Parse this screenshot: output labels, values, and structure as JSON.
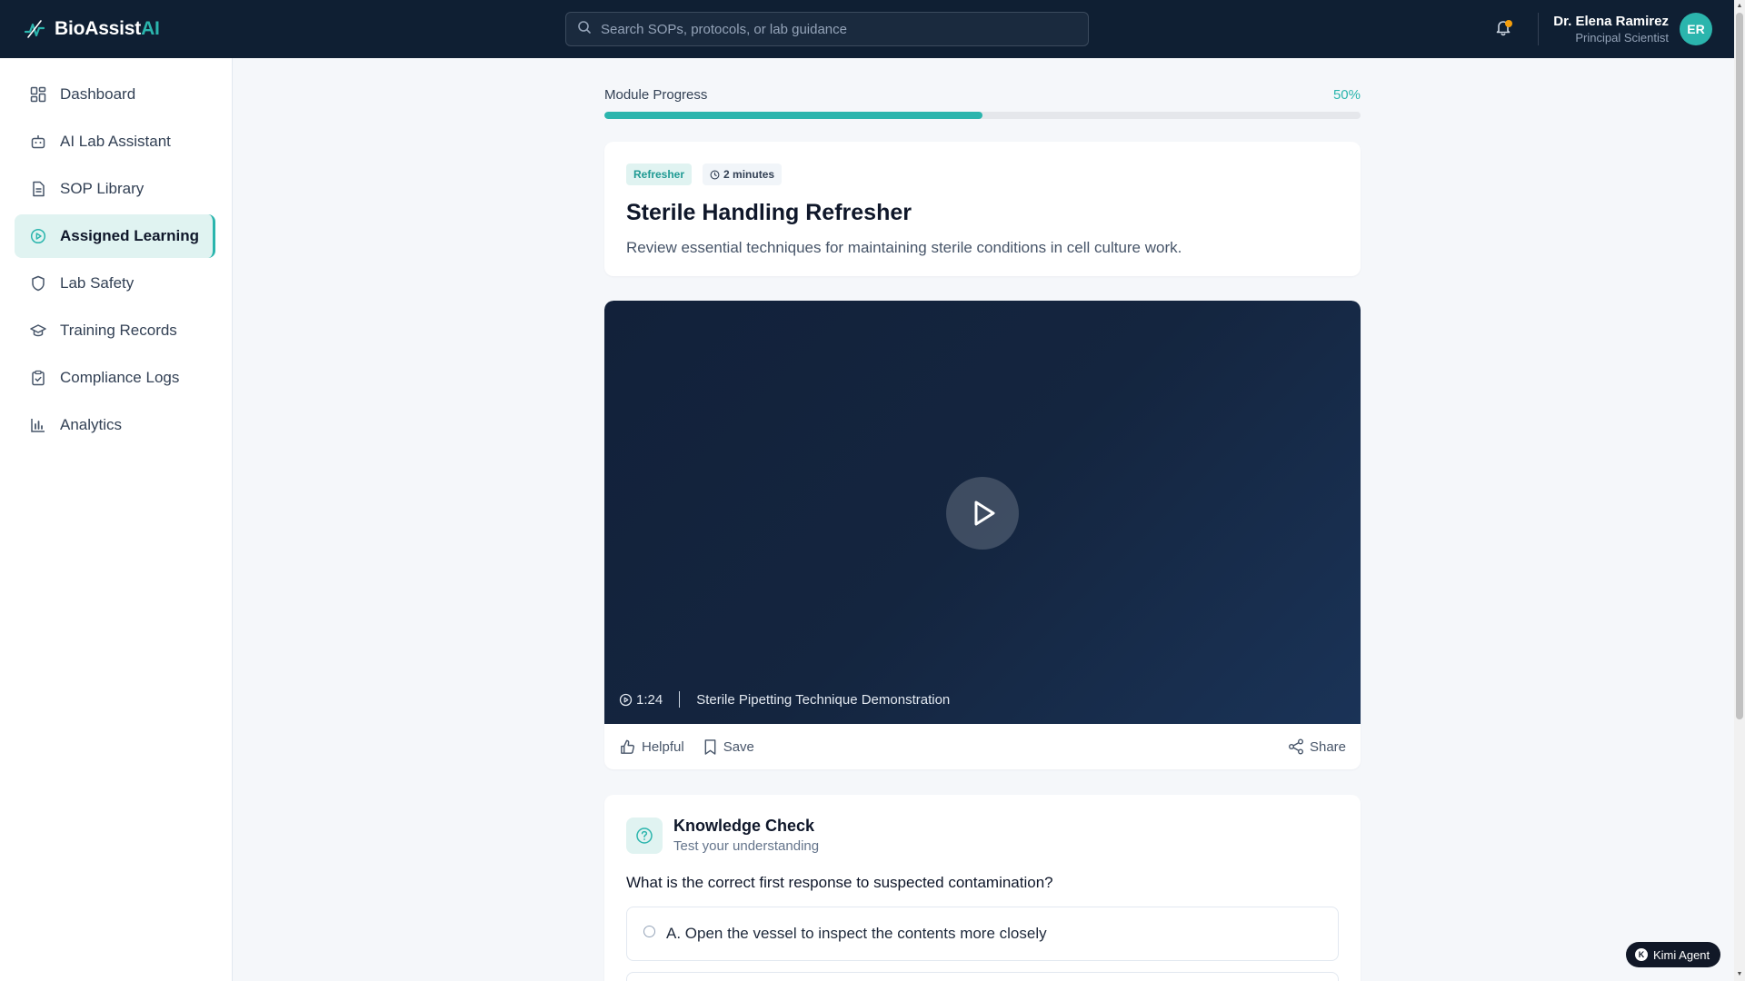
{
  "brand": {
    "name": "BioAssist",
    "suffix": "AI"
  },
  "search": {
    "placeholder": "Search SOPs, protocols, or lab guidance"
  },
  "user": {
    "name": "Dr. Elena Ramirez",
    "role": "Principal Scientist",
    "initials": "ER"
  },
  "sidebar": {
    "items": [
      {
        "label": "Dashboard",
        "icon": "dashboard-icon"
      },
      {
        "label": "AI Lab Assistant",
        "icon": "bot-icon"
      },
      {
        "label": "SOP Library",
        "icon": "document-icon"
      },
      {
        "label": "Assigned Learning",
        "icon": "play-circle-icon",
        "active": true
      },
      {
        "label": "Lab Safety",
        "icon": "shield-icon"
      },
      {
        "label": "Training Records",
        "icon": "graduation-cap-icon"
      },
      {
        "label": "Compliance Logs",
        "icon": "clipboard-check-icon"
      },
      {
        "label": "Analytics",
        "icon": "bar-chart-icon"
      }
    ]
  },
  "progress": {
    "label": "Module Progress",
    "percent_text": "50%",
    "value": 0.5
  },
  "module": {
    "tag": "Refresher",
    "duration": "2 minutes",
    "title": "Sterile Handling Refresher",
    "description": "Review essential techniques for maintaining sterile conditions in cell culture work."
  },
  "video": {
    "duration": "1:24",
    "caption": "Sterile Pipetting Technique Demonstration",
    "actions": {
      "helpful": "Helpful",
      "save": "Save",
      "share": "Share"
    }
  },
  "quiz": {
    "title": "Knowledge Check",
    "subtitle": "Test your understanding",
    "question": "What is the correct first response to suspected contamination?",
    "options": [
      "A. Open the vessel to inspect the contents more closely"
    ]
  },
  "agent": {
    "label": "Kimi Agent",
    "badge": "K"
  },
  "colors": {
    "accent": "#2bb5ad",
    "topbar": "#0f1f33",
    "notification": "#f59e0b"
  }
}
